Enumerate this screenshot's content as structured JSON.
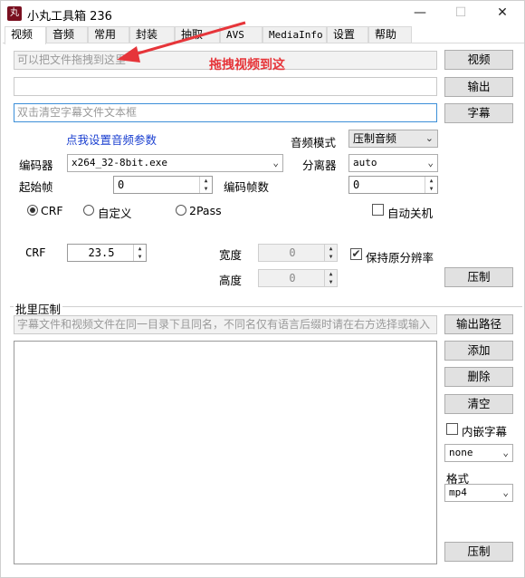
{
  "window": {
    "app_icon_text": "丸",
    "title": "小丸工具箱 236",
    "minimize": "—",
    "maximize": "☐",
    "close": "✕"
  },
  "tabs": [
    "视频",
    "音频",
    "常用",
    "封装",
    "抽取",
    "AVS",
    "MediaInfo",
    "设置",
    "帮助"
  ],
  "video": {
    "drop_placeholder": "可以把文件拖拽到这里",
    "video_button": "视频",
    "output_value": "",
    "output_button": "输出",
    "subtitle_placeholder": "双击清空字幕文件文本框",
    "subtitle_button": "字幕",
    "audio_params_link": "点我设置音频参数",
    "audio_mode_label": "音频模式",
    "audio_mode_value": "压制音频",
    "encoder_label": "编码器",
    "encoder_value": "x264_32-8bit.exe",
    "splitter_label": "分离器",
    "splitter_value": "auto",
    "start_frame_label": "起始帧",
    "start_frame_value": "0",
    "frame_count_label": "编码帧数",
    "frame_count_value": "0",
    "mode_crf": "CRF",
    "mode_custom": "自定义",
    "mode_2pass": "2Pass",
    "auto_shutdown": "自动关机",
    "crf_label": "CRF",
    "crf_value": "23.5",
    "width_label": "宽度",
    "width_value": "0",
    "height_label": "高度",
    "height_value": "0",
    "keep_resolution": "保持原分辨率",
    "encode_button": "压制"
  },
  "annotation": {
    "text": "拖拽视频到这",
    "color": "#e6353a"
  },
  "batch": {
    "group_title": "批里压制",
    "hint": "字幕文件和视频文件在同一目录下且同名，不同名仅有语言后缀时请在右方选择或输入",
    "output_path_button": "输出路径",
    "add_button": "添加",
    "delete_button": "删除",
    "clear_button": "清空",
    "embed_subtitle": "内嵌字幕",
    "subtitle_lang_value": "none",
    "format_label": "格式",
    "format_value": "mp4",
    "encode_button": "压制"
  }
}
